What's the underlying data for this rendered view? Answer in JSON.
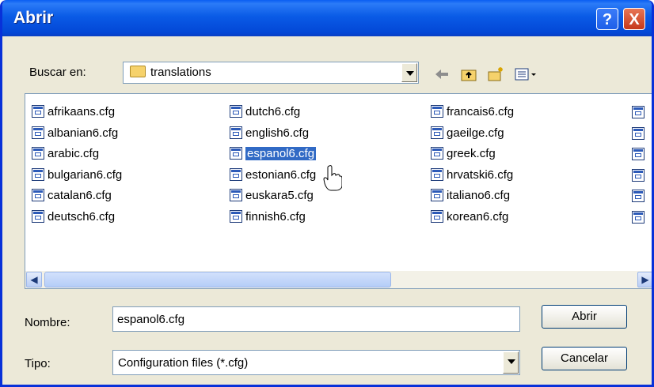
{
  "window": {
    "title": "Abrir"
  },
  "toolbar": {
    "look_in_label": "Buscar en:",
    "look_in_value": "translations"
  },
  "files": [
    {
      "name": "afrikaans.cfg"
    },
    {
      "name": "albanian6.cfg"
    },
    {
      "name": "arabic.cfg"
    },
    {
      "name": "bulgarian6.cfg"
    },
    {
      "name": "catalan6.cfg"
    },
    {
      "name": "deutsch6.cfg"
    },
    {
      "name": "dutch6.cfg"
    },
    {
      "name": "english6.cfg"
    },
    {
      "name": "espanol6.cfg",
      "selected": true
    },
    {
      "name": "estonian6.cfg"
    },
    {
      "name": "euskara5.cfg"
    },
    {
      "name": "finnish6.cfg"
    },
    {
      "name": "francais6.cfg"
    },
    {
      "name": "gaeilge.cfg"
    },
    {
      "name": "greek.cfg"
    },
    {
      "name": "hrvatski6.cfg"
    },
    {
      "name": "italiano6.cfg"
    },
    {
      "name": "korean6.cfg"
    }
  ],
  "form": {
    "name_label": "Nombre:",
    "name_value": "espanol6.cfg",
    "type_label": "Tipo:",
    "type_value": "Configuration files (*.cfg)"
  },
  "buttons": {
    "open": "Abrir",
    "cancel": "Cancelar"
  },
  "title_buttons": {
    "help": "?",
    "close": "X"
  }
}
